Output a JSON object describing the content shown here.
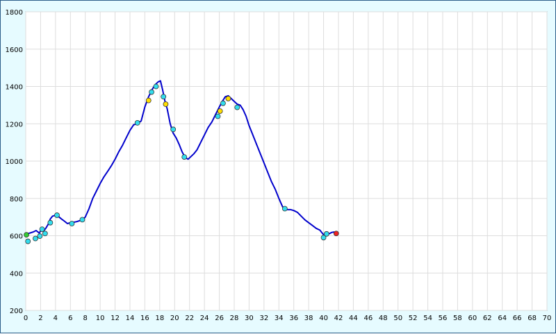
{
  "chart_data": {
    "type": "line",
    "title": "",
    "xlabel": "",
    "ylabel": "",
    "xlim": [
      0,
      70
    ],
    "ylim": [
      200,
      1800
    ],
    "x_ticks": [
      0,
      2,
      4,
      6,
      8,
      10,
      12,
      14,
      16,
      18,
      20,
      22,
      24,
      26,
      28,
      30,
      32,
      34,
      36,
      38,
      40,
      42,
      44,
      46,
      48,
      50,
      52,
      54,
      56,
      58,
      60,
      62,
      64,
      66,
      68,
      70
    ],
    "y_ticks": [
      200,
      400,
      600,
      800,
      1000,
      1200,
      1400,
      1600,
      1800
    ],
    "grid": true,
    "series": [
      {
        "color": "#0000cc",
        "x": [
          0,
          0.3,
          0.6,
          1.0,
          1.4,
          1.8,
          2.1,
          2.4,
          2.7,
          3.0,
          3.3,
          3.6,
          4.0,
          4.4,
          4.8,
          5.2,
          5.6,
          6.0,
          6.4,
          6.8,
          7.2,
          7.6,
          8.0,
          8.5,
          9.0,
          9.5,
          10.0,
          10.5,
          11.0,
          11.5,
          12.0,
          12.5,
          13.0,
          13.5,
          14.0,
          14.5,
          15.0,
          15.5,
          16.0,
          16.5,
          17.0,
          17.4,
          17.8,
          18.1,
          18.4,
          18.7,
          19.0,
          19.4,
          19.8,
          20.2,
          20.6,
          21.0,
          21.4,
          21.8,
          22.2,
          22.6,
          23.0,
          23.5,
          24.0,
          24.5,
          25.0,
          25.5,
          26.0,
          26.4,
          26.8,
          27.2,
          27.6,
          28.0,
          28.4,
          28.8,
          29.2,
          29.6,
          30.0,
          30.5,
          31.0,
          31.5,
          32.0,
          32.5,
          33.0,
          33.5,
          34.0,
          34.5,
          34.8,
          35.2,
          35.6,
          36.0,
          36.5,
          37.0,
          37.5,
          38.0,
          38.5,
          39.0,
          39.5,
          39.9,
          40.2,
          40.5,
          40.8,
          41.1,
          41.4,
          41.7
        ],
        "y": [
          605,
          612,
          615,
          620,
          628,
          615,
          630,
          625,
          640,
          660,
          690,
          705,
          710,
          703,
          690,
          678,
          665,
          670,
          672,
          675,
          680,
          686,
          700,
          745,
          800,
          840,
          880,
          915,
          945,
          975,
          1010,
          1050,
          1085,
          1125,
          1165,
          1195,
          1200,
          1215,
          1290,
          1345,
          1385,
          1410,
          1425,
          1430,
          1380,
          1320,
          1280,
          1200,
          1150,
          1125,
          1090,
          1050,
          1020,
          1010,
          1025,
          1040,
          1060,
          1100,
          1140,
          1180,
          1210,
          1250,
          1290,
          1320,
          1345,
          1350,
          1335,
          1320,
          1305,
          1300,
          1275,
          1240,
          1190,
          1140,
          1090,
          1040,
          990,
          940,
          890,
          850,
          800,
          755,
          745,
          740,
          740,
          735,
          725,
          705,
          685,
          670,
          655,
          640,
          630,
          610,
          598,
          605,
          612,
          618,
          620,
          610
        ]
      }
    ],
    "markers": [
      {
        "x": 0.1,
        "y": 605,
        "color": "#33cc33"
      },
      {
        "x": 0.3,
        "y": 570,
        "color": "#33ddee"
      },
      {
        "x": 1.3,
        "y": 585,
        "color": "#33ddee"
      },
      {
        "x": 1.9,
        "y": 598,
        "color": "#33ddee"
      },
      {
        "x": 2.2,
        "y": 635,
        "color": "#33ddee"
      },
      {
        "x": 2.6,
        "y": 612,
        "color": "#33ddee"
      },
      {
        "x": 3.3,
        "y": 670,
        "color": "#33ddee"
      },
      {
        "x": 4.2,
        "y": 710,
        "color": "#33ddee"
      },
      {
        "x": 6.2,
        "y": 665,
        "color": "#33ddee"
      },
      {
        "x": 7.6,
        "y": 686,
        "color": "#33ddee"
      },
      {
        "x": 15.0,
        "y": 1205,
        "color": "#33ddee"
      },
      {
        "x": 16.5,
        "y": 1325,
        "color": "#ffdd00"
      },
      {
        "x": 16.9,
        "y": 1370,
        "color": "#33ddee"
      },
      {
        "x": 17.5,
        "y": 1400,
        "color": "#33ddee"
      },
      {
        "x": 18.5,
        "y": 1345,
        "color": "#33ddee"
      },
      {
        "x": 18.8,
        "y": 1305,
        "color": "#ffdd00"
      },
      {
        "x": 19.8,
        "y": 1170,
        "color": "#33ddee"
      },
      {
        "x": 21.3,
        "y": 1022,
        "color": "#33ddee"
      },
      {
        "x": 25.8,
        "y": 1240,
        "color": "#33ddee"
      },
      {
        "x": 26.1,
        "y": 1268,
        "color": "#ffdd00"
      },
      {
        "x": 26.5,
        "y": 1310,
        "color": "#33ddee"
      },
      {
        "x": 27.2,
        "y": 1335,
        "color": "#ffdd00"
      },
      {
        "x": 28.4,
        "y": 1288,
        "color": "#33ddee"
      },
      {
        "x": 34.8,
        "y": 745,
        "color": "#33ddee"
      },
      {
        "x": 40.0,
        "y": 590,
        "color": "#33ddee"
      },
      {
        "x": 40.4,
        "y": 610,
        "color": "#33ddee"
      },
      {
        "x": 41.7,
        "y": 612,
        "color": "#ee2222"
      }
    ],
    "colors": {
      "background": "#e6fbff",
      "plot_area": "#ffffff",
      "grid": "#dddddd",
      "border": "#2a5d88"
    }
  }
}
